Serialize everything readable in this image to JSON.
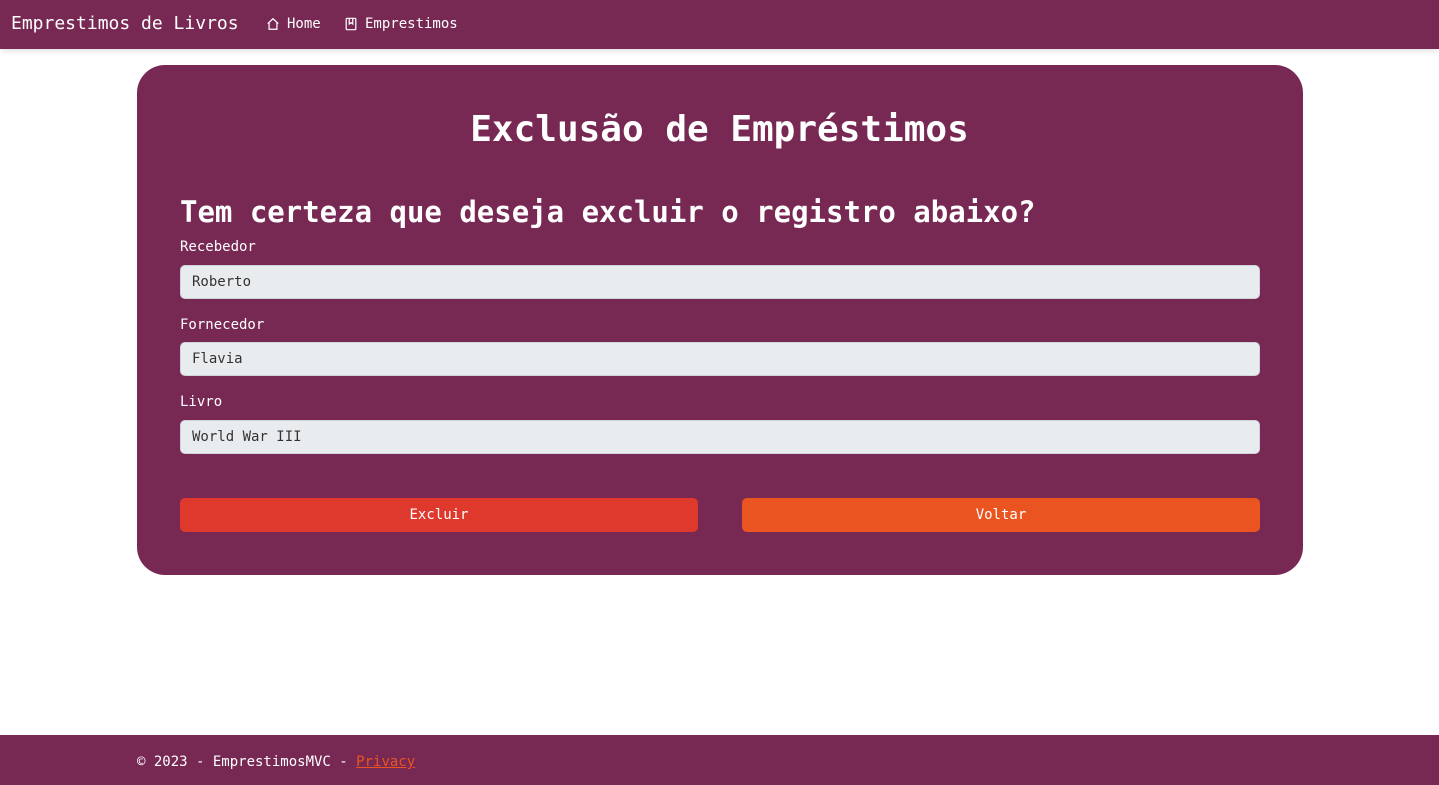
{
  "navbar": {
    "brand": "Emprestimos de Livros",
    "links": [
      {
        "label": "Home",
        "icon": "home-icon"
      },
      {
        "label": "Emprestimos",
        "icon": "book-icon"
      }
    ]
  },
  "card": {
    "title": "Exclusão de Empréstimos",
    "question": "Tem certeza que deseja excluir o registro abaixo?",
    "fields": [
      {
        "label": "Recebedor",
        "value": "Roberto"
      },
      {
        "label": "Fornecedor",
        "value": "Flavia"
      },
      {
        "label": "Livro",
        "value": "World War III"
      }
    ],
    "buttons": {
      "delete_label": "Excluir",
      "back_label": "Voltar"
    }
  },
  "footer": {
    "text": "© 2023 - EmprestimosMVC - ",
    "privacy_label": "Privacy"
  },
  "colors": {
    "primary": "#772953",
    "danger": "#df382c",
    "warning": "#e95420",
    "input_bg": "#e9ecef"
  }
}
